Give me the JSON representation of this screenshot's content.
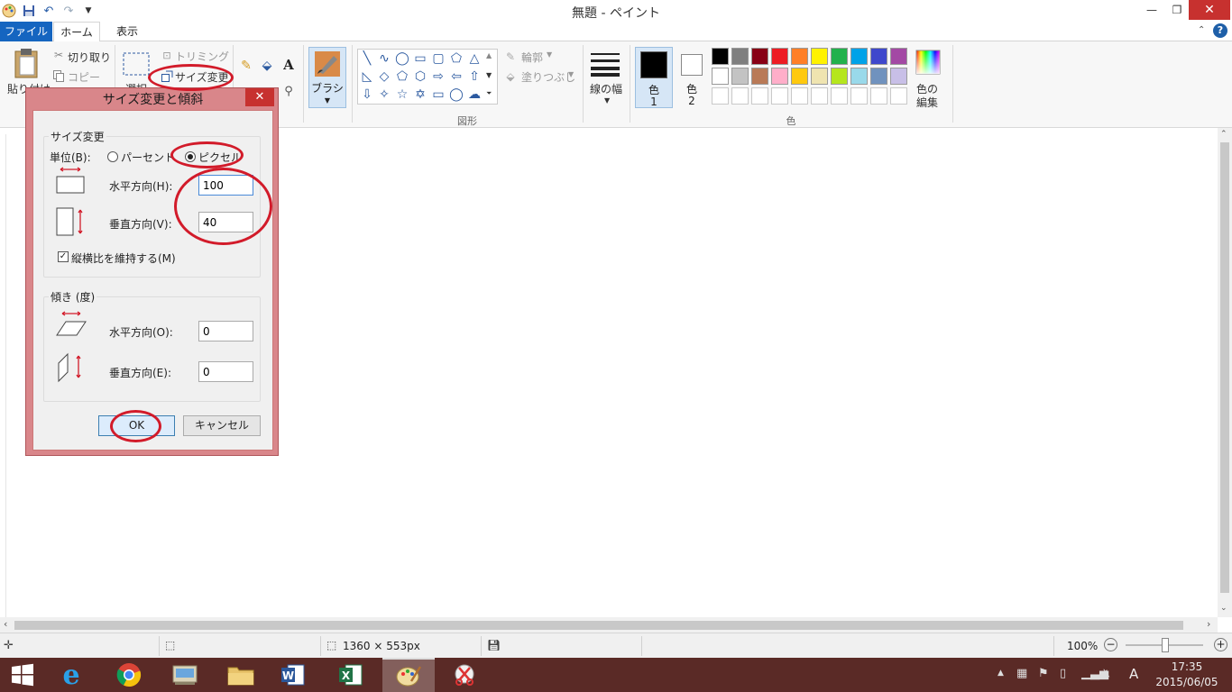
{
  "window": {
    "title": "無題 - ペイント",
    "minimize": "—",
    "restore": "❐",
    "close": "✕"
  },
  "qat": {
    "icons": [
      "paint-app-icon",
      "save-icon",
      "undo-icon",
      "redo-icon",
      "customize-icon"
    ]
  },
  "tabs": {
    "file": "ファイル",
    "home": "ホーム",
    "view": "表示",
    "help": "?"
  },
  "ribbon": {
    "clipboard": {
      "paste": "貼り付け",
      "cut": "切り取り",
      "copy": "コピー"
    },
    "image": {
      "select": "選択",
      "crop": "トリミング",
      "resize": "サイズ変更"
    },
    "tools": {},
    "brushes": "ブラシ",
    "shapes": {
      "outline": "輪郭",
      "fill": "塗りつぶし",
      "group_label": "図形"
    },
    "size": "線の幅",
    "colors": {
      "color1_line1": "色",
      "color1_line2": "1",
      "color2_line1": "色",
      "color2_line2": "2",
      "edit_line1": "色の",
      "edit_line2": "編集",
      "group_label": "色",
      "palette_row1": [
        "#000000",
        "#7f7f7f",
        "#880015",
        "#ed1c24",
        "#ff7f27",
        "#fff200",
        "#22b14c",
        "#00a2e8",
        "#3f48cc",
        "#a349a4"
      ],
      "palette_row2": [
        "#ffffff",
        "#c3c3c3",
        "#b97a57",
        "#ffaec9",
        "#ffc90e",
        "#efe4b0",
        "#b5e61d",
        "#99d9ea",
        "#7092be",
        "#c8bfe7"
      ]
    }
  },
  "dialog": {
    "title": "サイズ変更と傾斜",
    "close": "✕",
    "resize_legend": "サイズ変更",
    "unit_label": "単位(B):",
    "percent": "パーセント",
    "pixel": "ピクセル",
    "horizontal_label": "水平方向(H):",
    "horizontal_value": "100",
    "vertical_label": "垂直方向(V):",
    "vertical_value": "40",
    "keep_ratio": "縦横比を維持する(M)",
    "skew_legend": "傾き (度)",
    "skew_h_label": "水平方向(O):",
    "skew_h_value": "0",
    "skew_v_label": "垂直方向(E):",
    "skew_v_value": "0",
    "ok": "OK",
    "cancel": "キャンセル"
  },
  "status": {
    "image_size": "1360 × 553px",
    "zoom": "100%"
  },
  "taskbar": {
    "time": "17:35",
    "date": "2015/06/05",
    "ime": "A",
    "apps": [
      "windows-start",
      "internet-explorer",
      "chrome",
      "control-panel",
      "file-explorer",
      "word",
      "excel",
      "paint",
      "snipping-tool"
    ]
  },
  "colors": {
    "accent": "#1565c0",
    "annotation": "#d21b2a",
    "dialog_frame": "#d9868a",
    "taskbar": "#5a2a26"
  }
}
